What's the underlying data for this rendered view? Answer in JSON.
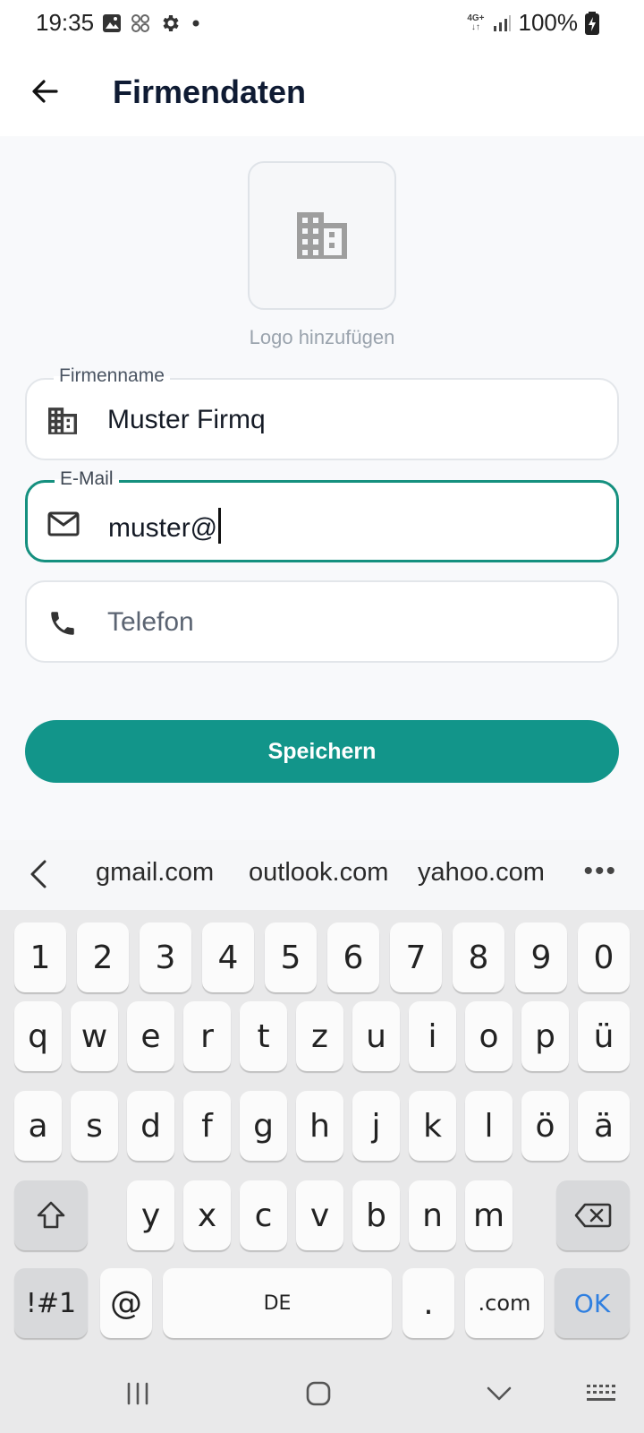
{
  "status_bar": {
    "time": "19:35",
    "network_top": "4G+",
    "battery": "100%",
    "left_icons": [
      "image-icon",
      "pinwheel-icon",
      "gear-icon",
      "dot-icon"
    ],
    "right_icons": [
      "network-icon",
      "signal-icon",
      "battery-charging-icon"
    ]
  },
  "appbar": {
    "title": "Firmendaten",
    "back_icon": "arrow-left-icon"
  },
  "logo": {
    "icon": "building-icon",
    "label": "Logo hinzufügen"
  },
  "form": {
    "company": {
      "label": "Firmenname",
      "value": "Muster Firmq",
      "icon": "building-icon"
    },
    "email": {
      "label": "E-Mail",
      "value": "muster@",
      "icon": "mail-icon",
      "focused": true
    },
    "phone": {
      "placeholder": "Telefon",
      "value": "",
      "icon": "phone-icon"
    }
  },
  "save_button": {
    "label": "Speichern",
    "color": "#12958a"
  },
  "suggestions": {
    "items": [
      "gmail.com",
      "outlook.com",
      "yahoo.com"
    ],
    "more": "•••"
  },
  "keyboard": {
    "row_numbers": [
      "1",
      "2",
      "3",
      "4",
      "5",
      "6",
      "7",
      "8",
      "9",
      "0"
    ],
    "row_1": [
      "q",
      "w",
      "e",
      "r",
      "t",
      "z",
      "u",
      "i",
      "o",
      "p",
      "ü"
    ],
    "row_2": [
      "a",
      "s",
      "d",
      "f",
      "g",
      "h",
      "j",
      "k",
      "l",
      "ö",
      "ä"
    ],
    "row_3": [
      "y",
      "x",
      "c",
      "v",
      "b",
      "n",
      "m"
    ],
    "symbols": "!#1",
    "at": "@",
    "space": "DE",
    "dot": ".",
    "dotcom": ".com",
    "ok": "OK",
    "accent_color": "#2f7fe0"
  },
  "navbar": {
    "icons": [
      "recent-apps-icon",
      "home-icon",
      "hide-keyboard-icon",
      "keyboard-icon"
    ]
  },
  "colors": {
    "accent": "#15907f",
    "title": "#0f1b33"
  }
}
